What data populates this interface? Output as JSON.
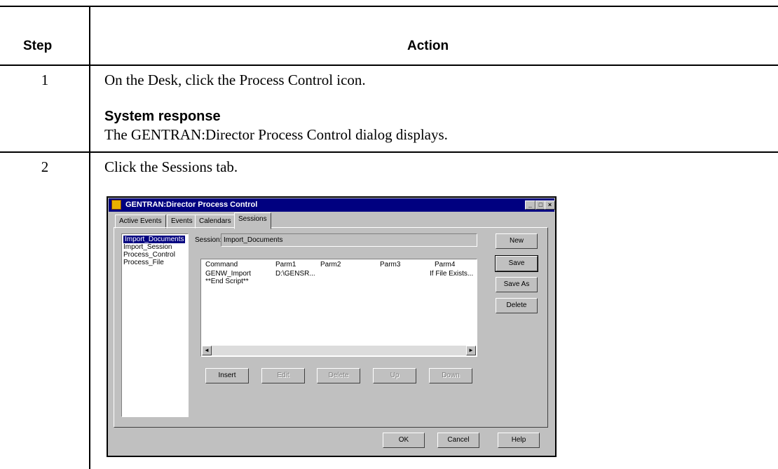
{
  "table": {
    "headers": {
      "step": "Step",
      "action": "Action"
    },
    "rows": [
      {
        "step": "1",
        "text": "On the Desk, click the Process Control icon.",
        "response_heading": "System response",
        "response_text": "The GENTRAN:Director Process Control dialog displays."
      },
      {
        "step": "2",
        "text": "Click the Sessions tab."
      }
    ]
  },
  "dialog": {
    "title": "GENTRAN:Director Process Control",
    "tabs": [
      "Active Events",
      "Events",
      "Calendars",
      "Sessions"
    ],
    "active_tab": "Sessions",
    "session_label": "Session:",
    "session_value": "Import_Documents",
    "session_list": [
      "Import_Documents",
      "Import_Session",
      "Process_Control",
      "Process_File"
    ],
    "selected_session": "Import_Documents",
    "columns": [
      "Command",
      "Parm1",
      "Parm2",
      "Parm3",
      "Parm4"
    ],
    "rows": [
      [
        "GENW_Import",
        "D:\\GENSR...",
        "",
        "",
        "If File Exists..."
      ],
      [
        "**End Script**",
        "",
        "",
        "",
        ""
      ]
    ],
    "side_buttons": [
      "New",
      "Save",
      "Save As",
      "Delete"
    ],
    "action_buttons": [
      "Insert",
      "Edit",
      "Delete",
      "Up",
      "Down"
    ],
    "footer_buttons": [
      "OK",
      "Cancel",
      "Help"
    ],
    "window_buttons": {
      "minimize": "_",
      "maximize": "□",
      "close": "×"
    }
  }
}
